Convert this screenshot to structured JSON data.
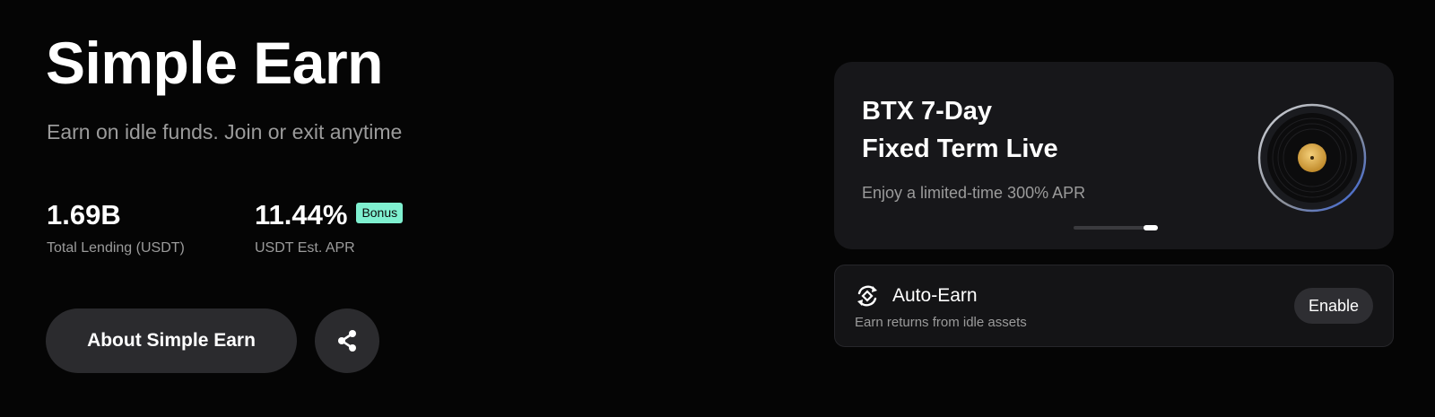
{
  "hero": {
    "title": "Simple Earn",
    "subtitle": "Earn on idle funds. Join or exit anytime"
  },
  "stats": {
    "lending": {
      "value": "1.69B",
      "label": "Total Lending (USDT)"
    },
    "apr": {
      "value": "11.44%",
      "label": "USDT Est. APR",
      "badge": "Bonus"
    }
  },
  "actions": {
    "about_label": "About Simple Earn",
    "share_icon": "share-icon"
  },
  "promo": {
    "title_line1": "BTX 7-Day",
    "title_line2": "Fixed Term Live",
    "subtitle": "Enjoy a limited-time 300% APR",
    "image_icon": "vinyl-disc-icon",
    "carousel_progress": 1.0
  },
  "auto_earn": {
    "icon": "auto-earn-cycle-icon",
    "title": "Auto-Earn",
    "subtitle": "Earn returns from idle assets",
    "enable_label": "Enable"
  },
  "colors": {
    "background": "#050505",
    "card": "#17171a",
    "badge": "#7ff0d0",
    "muted_text": "#9b9b9b",
    "button": "#2b2b2e"
  }
}
